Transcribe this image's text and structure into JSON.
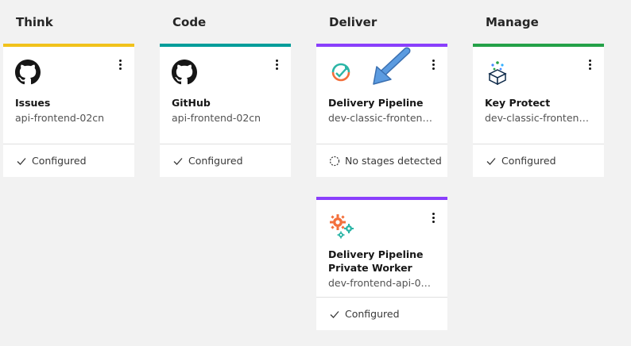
{
  "columns": {
    "think": "Think",
    "code": "Code",
    "deliver": "Deliver",
    "manage": "Manage"
  },
  "colors": {
    "think": "#f1c21b",
    "code": "#009d9a",
    "deliver": "#8a3ffc",
    "manage": "#24a148",
    "arrow": "#4a90d9"
  },
  "cards": {
    "issues": {
      "name": "Issues",
      "sub": "api-frontend-02cn",
      "status": "Configured",
      "icon": "github-icon"
    },
    "github": {
      "name": "GitHub",
      "sub": "api-frontend-02cn",
      "status": "Configured",
      "icon": "github-icon"
    },
    "pipeline": {
      "name": "Delivery Pipeline",
      "sub": "dev-classic-frontend...",
      "status": "No stages detected",
      "icon": "pipeline-icon"
    },
    "keyprotect": {
      "name": "Key Protect",
      "sub": "dev-classic-frontend...",
      "status": "Configured",
      "icon": "key-protect-icon"
    },
    "worker": {
      "name": "Delivery Pipeline Private Worker",
      "sub": "dev-frontend-api-02...",
      "status": "Configured",
      "icon": "gears-icon"
    }
  }
}
